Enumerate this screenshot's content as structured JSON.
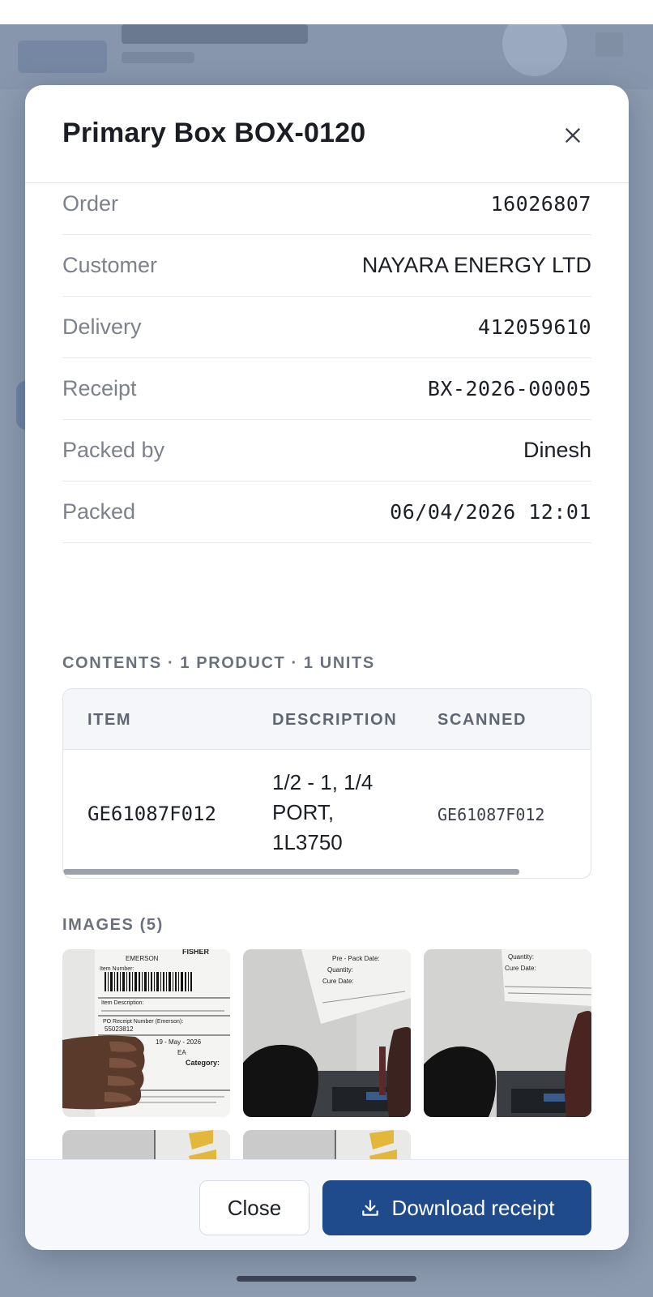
{
  "modal": {
    "title": "Primary Box BOX-0120"
  },
  "details": [
    {
      "label": "Order",
      "value": "16026807"
    },
    {
      "label": "Customer",
      "value": "NAYARA ENERGY LTD"
    },
    {
      "label": "Delivery",
      "value": "412059610"
    },
    {
      "label": "Receipt",
      "value": "BX-2026-00005"
    },
    {
      "label": "Packed by",
      "value": "Dinesh"
    },
    {
      "label": "Packed",
      "value": "06/04/2026 12:01"
    }
  ],
  "contents": {
    "title": "CONTENTS · 1 PRODUCT · 1 UNITS",
    "columns": [
      "ITEM",
      "DESCRIPTION",
      "SCANNED"
    ],
    "rows": [
      {
        "item": "GE61087F012",
        "description": "1/2 - 1, 1/4 PORT, 1L3750",
        "scanned": "GE61087F012"
      }
    ]
  },
  "images": {
    "title": "IMAGES (5)",
    "label_text": {
      "brand": "EMERSON",
      "brand2": "FISHER",
      "item_number": "Item Number:",
      "item_description": "Item Description:",
      "po_receipt": "PO Receipt Number (Emerson):",
      "po_value": "55023812",
      "date": "19 - May - 2026",
      "qty": "EA",
      "category": "Category:",
      "pre_pack": "Pre - Pack Date:",
      "quantity": "Quantity:",
      "cure_date": "Cure Date:"
    }
  },
  "footer": {
    "close_label": "Close",
    "download_label": "Download receipt"
  },
  "colors": {
    "primary": "#1f4b8c",
    "overlay": "#8d9bb0"
  }
}
